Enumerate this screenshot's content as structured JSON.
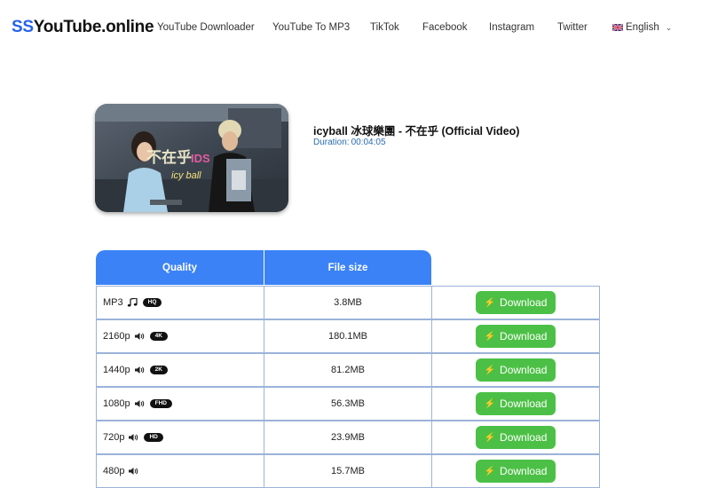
{
  "logo": {
    "part1": "SS",
    "part2": "YouTube.online"
  },
  "nav": [
    {
      "label": "YouTube Downloader"
    },
    {
      "label": "YouTube To MP3"
    },
    {
      "label": "TikTok"
    },
    {
      "label": "Facebook"
    },
    {
      "label": "Instagram"
    },
    {
      "label": "Twitter"
    }
  ],
  "language": {
    "label": "English",
    "flag": "uk-flag-icon"
  },
  "video": {
    "title": "icyball 冰球樂團 - 不在乎 (Official Video)",
    "duration_label": "Duration:",
    "duration": "00:04:05"
  },
  "table": {
    "headers": {
      "quality": "Quality",
      "size": "File size"
    },
    "download_label": "Download",
    "rows": [
      {
        "quality": "MP3",
        "icon": "music-note-icon",
        "badge": "HQ",
        "size": "3.8MB"
      },
      {
        "quality": "2160p",
        "icon": "speaker-icon",
        "badge": "4K",
        "size": "180.1MB"
      },
      {
        "quality": "1440p",
        "icon": "speaker-icon",
        "badge": "2K",
        "size": "81.2MB"
      },
      {
        "quality": "1080p",
        "icon": "speaker-icon",
        "badge": "FHD",
        "size": "56.3MB"
      },
      {
        "quality": "720p",
        "icon": "speaker-icon",
        "badge": "HD",
        "size": "23.9MB"
      },
      {
        "quality": "480p",
        "icon": "speaker-icon",
        "badge": "",
        "size": "15.7MB"
      }
    ]
  },
  "colors": {
    "accent": "#3b82f6",
    "download": "#4cc046",
    "logo_ss": "#2563eb"
  }
}
